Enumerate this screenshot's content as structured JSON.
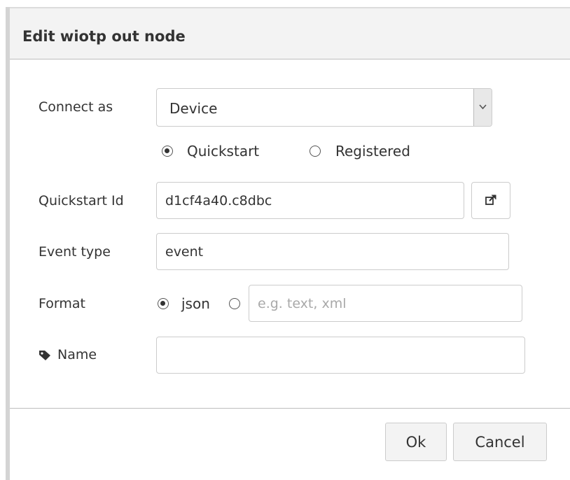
{
  "dialog": {
    "title": "Edit wiotp out node"
  },
  "connect_as": {
    "label": "Connect as",
    "selected": "Device",
    "options": [
      {
        "label": "Quickstart",
        "checked": true
      },
      {
        "label": "Registered",
        "checked": false
      }
    ]
  },
  "quickstart_id": {
    "label": "Quickstart Id",
    "value": "d1cf4a40.c8dbc",
    "open_icon": "external-link-icon"
  },
  "event_type": {
    "label": "Event type",
    "value": "event"
  },
  "format": {
    "label": "Format",
    "json_label": "json",
    "json_checked": true,
    "custom_checked": false,
    "custom_placeholder": "e.g. text, xml",
    "custom_value": ""
  },
  "name": {
    "label": "Name",
    "icon": "tag-icon",
    "value": ""
  },
  "buttons": {
    "ok": "Ok",
    "cancel": "Cancel"
  },
  "colors": {
    "titlebar": "#f3f3f3",
    "border": "#cccccc",
    "text": "#333333",
    "placeholder": "#a9a9a9"
  }
}
